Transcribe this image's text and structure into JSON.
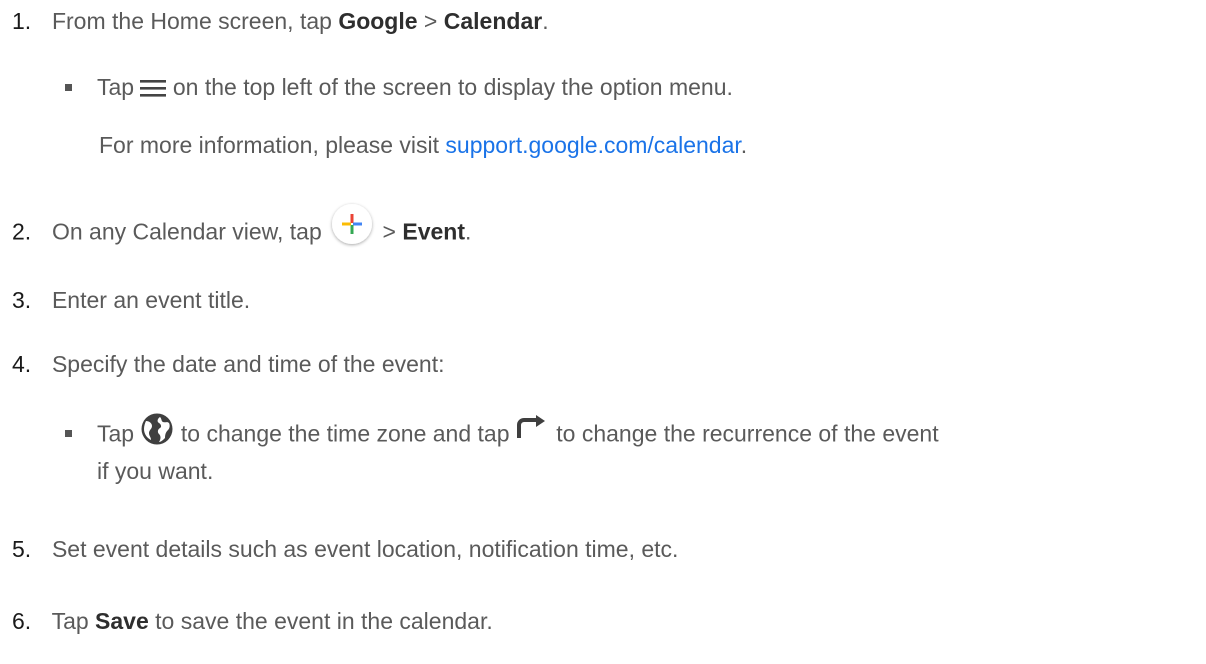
{
  "steps": [
    {
      "num": "1.",
      "pre": "From the Home screen, tap ",
      "b1": "Google",
      "mid": " > ",
      "b2": "Calendar",
      "post": "."
    },
    {
      "num": "2.",
      "pre": "On any Calendar view, tap",
      "sep": " > ",
      "b": "Event",
      "post": "."
    },
    {
      "num": "3.",
      "text": "Enter an event title."
    },
    {
      "num": "4.",
      "text": "Specify the date and time of the event:"
    },
    {
      "num": "5.",
      "text": "Set event details such as event location, notification time, etc."
    },
    {
      "num": "6.",
      "pre": "Tap ",
      "b": "Save",
      "post": " to save the event in the calendar."
    }
  ],
  "sub1": {
    "pre": "Tap ",
    "post": " on the top left of the screen to display the option menu.",
    "info_pre": "For more information, please visit ",
    "link": "support.google.com/calendar",
    "info_post": "."
  },
  "sub4": {
    "pre": "Tap ",
    "mid": " to change the time zone and tap ",
    "post": "  to change the recurrence of the event",
    "cont": "if you want."
  },
  "icons": {
    "menu": "hamburger-menu-icon",
    "add": "plus-fab-icon",
    "globe": "globe-icon",
    "repeat": "repeat-icon"
  },
  "colors": {
    "link": "#1a73e8",
    "plus_red": "#ea4335",
    "plus_blue": "#4285f4",
    "plus_yellow": "#fbbc04",
    "plus_green": "#34a853"
  }
}
